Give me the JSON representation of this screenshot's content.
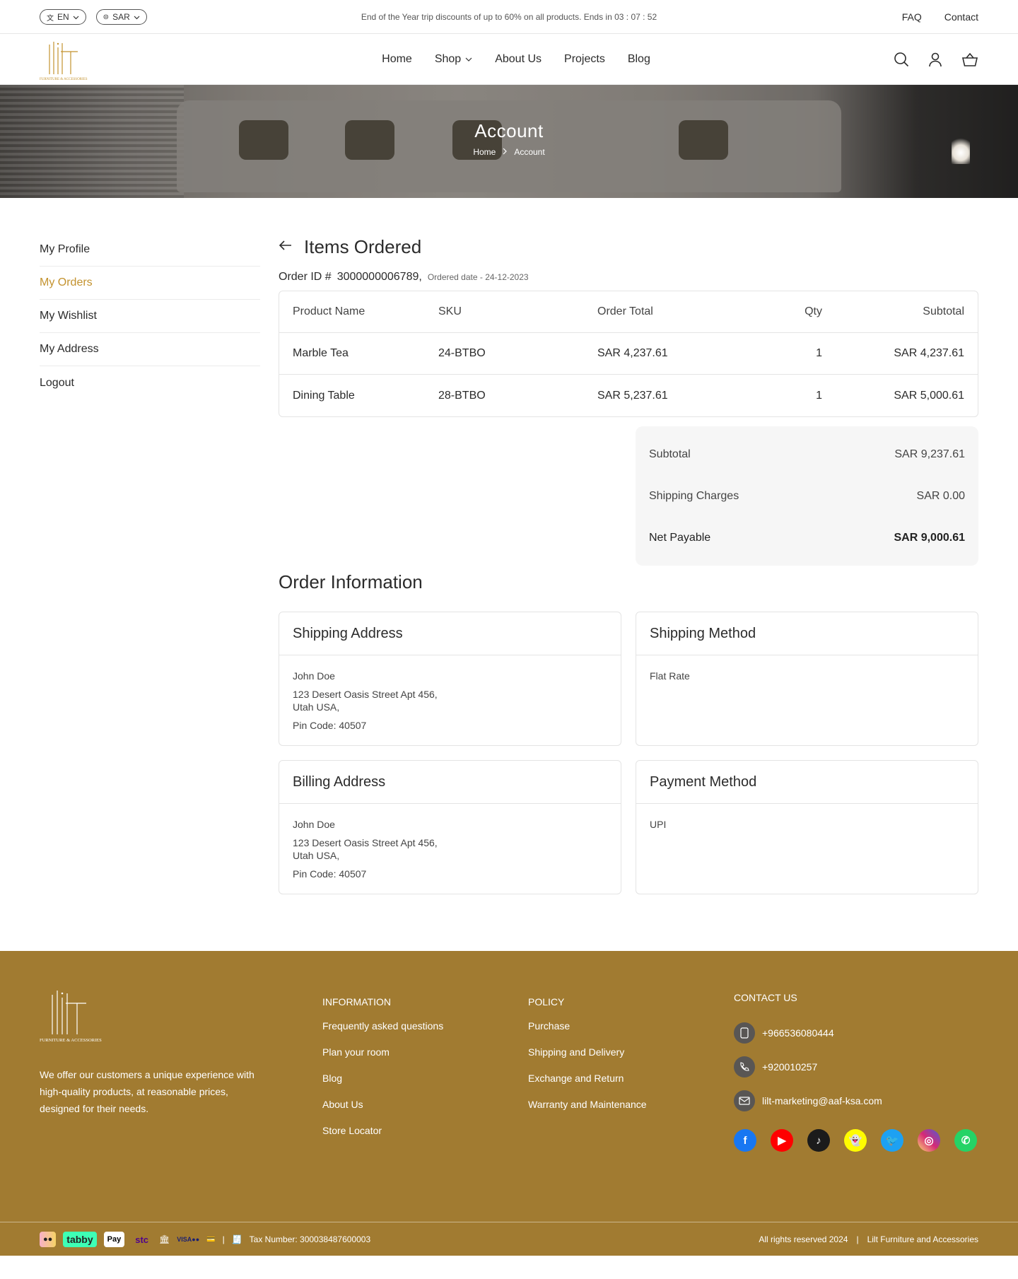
{
  "topbar": {
    "language": "EN",
    "currency": "SAR",
    "announcement": "End of the Year trip discounts of up to 60% on all products. Ends in 03 : 07 : 52",
    "links": [
      "FAQ",
      "Contact"
    ]
  },
  "brand": {
    "logo_text": "lilt",
    "logo_sub": "FURNITURE & ACCESSORIES",
    "accent_color": "#c3922e",
    "footer_color": "#a17b31"
  },
  "nav": {
    "items": [
      "Home",
      "Shop",
      "About Us",
      "Projects",
      "Blog"
    ]
  },
  "header_icons": [
    "search-icon",
    "user-icon",
    "cart-icon"
  ],
  "hero": {
    "title": "Account",
    "breadcrumb": [
      "Home",
      "Account"
    ]
  },
  "sidebar": {
    "items": [
      "My Profile",
      "My Orders",
      "My Wishlist",
      "My Address",
      "Logout"
    ],
    "active": "My Orders"
  },
  "order": {
    "heading": "Items Ordered",
    "id_label": "Order ID #",
    "id_value": "3000000006789,",
    "date_text": "Ordered date - 24-12-2023",
    "columns": [
      "Product Name",
      "SKU",
      "Order Total",
      "Qty",
      "Subtotal"
    ],
    "rows": [
      [
        "Marble Tea",
        "24-BTBO",
        "SAR 4,237.61",
        "1",
        "SAR 4,237.61"
      ],
      [
        "Dining Table",
        "28-BTBO",
        "SAR 5,237.61",
        "1",
        "SAR 5,000.61"
      ]
    ],
    "summary": [
      {
        "label": "Subtotal",
        "value": "SAR 9,237.61"
      },
      {
        "label": "Shipping Charges",
        "value": "SAR 0.00"
      },
      {
        "label": "Net Payable",
        "value": "SAR 9,000.61"
      }
    ]
  },
  "order_info": {
    "title": "Order Information",
    "shipping_address": {
      "title": "Shipping Address",
      "name": "John Doe",
      "line1": "123 Desert Oasis Street Apt 456,",
      "line2": "Utah USA,",
      "pin": "Pin Code: 40507"
    },
    "shipping_method": {
      "title": "Shipping Method",
      "value": "Flat Rate"
    },
    "billing_address": {
      "title": "Billing Address",
      "name": "John Doe",
      "line1": "123 Desert Oasis Street Apt 456,",
      "line2": "Utah USA,",
      "pin": "Pin Code: 40507"
    },
    "payment_method": {
      "title": "Payment Method",
      "value": "UPI"
    }
  },
  "footer": {
    "description": "We offer our customers a unique experience with high-quality products, at reasonable prices, designed for their needs.",
    "information": {
      "title": "INFORMATION",
      "links": [
        "Frequently asked questions",
        "Plan your room",
        "Blog",
        "About Us",
        "Store Locator"
      ]
    },
    "policy": {
      "title": "POLICY",
      "links": [
        "Purchase",
        "Shipping and Delivery",
        "Exchange and Return",
        "Warranty and Maintenance"
      ]
    },
    "contact": {
      "title": "CONTACT US",
      "mobile": "+966536080444",
      "phone": "+920010257",
      "email": "lilt-marketing@aaf-ksa.com"
    },
    "socials": [
      "facebook-icon",
      "youtube-icon",
      "tiktok-icon",
      "snapchat-icon",
      "twitter-icon",
      "instagram-icon",
      "whatsapp-icon"
    ],
    "payments": [
      "tabby",
      "Pay",
      "stc"
    ],
    "tax": "Tax Number: 300038487600003",
    "rights": "All rights reserved 2024",
    "company": "Lilt Furniture and Accessories"
  }
}
